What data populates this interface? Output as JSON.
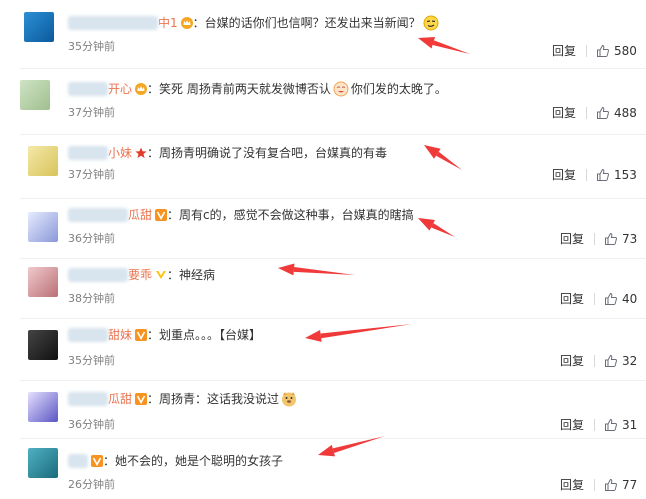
{
  "reply_label": "回复",
  "comments": [
    {
      "name_visible": "中1",
      "badge": "crown",
      "text": "：台媒的话你们也信啊？还发出来当新闻？",
      "time": "35分钟前",
      "likes": "580",
      "emoji": "smug"
    },
    {
      "name_visible": "开心",
      "badge": "crown",
      "text": "：笑死 周扬青前两天就发微博否认",
      "text2": "你们发的太晚了。",
      "time": "37分钟前",
      "likes": "488",
      "emoji": "laugh"
    },
    {
      "name_visible": "小妹",
      "badge": "star",
      "text": "：周扬青明确说了没有复合吧，台媒真的有毒",
      "time": "37分钟前",
      "likes": "153"
    },
    {
      "name_visible": "瓜甜",
      "badge": "v",
      "text": "：周有c的，感觉不会做这种事，台媒真的瞎搞",
      "time": "36分钟前",
      "likes": "73"
    },
    {
      "name_visible": "要乖",
      "badge": "vy",
      "text": "：神经病",
      "time": "38分钟前",
      "likes": "40"
    },
    {
      "name_visible": "甜妹",
      "badge": "v",
      "text": "：划重点。。。【台媒】",
      "time": "35分钟前",
      "likes": "32"
    },
    {
      "name_visible": "瓜甜",
      "badge": "v",
      "text": "：周扬青：这话我没说过",
      "time": "36分钟前",
      "likes": "31",
      "emoji": "doge"
    },
    {
      "name_visible": "",
      "badge": "v",
      "text": "：她不会的，她是个聪明的女孩子",
      "time": "26分钟前",
      "likes": "77"
    }
  ],
  "colors": {
    "name": "#eb7350",
    "arrow": "#f03a3a",
    "badge_v": "#f7931e",
    "crown": "#f5a623"
  }
}
